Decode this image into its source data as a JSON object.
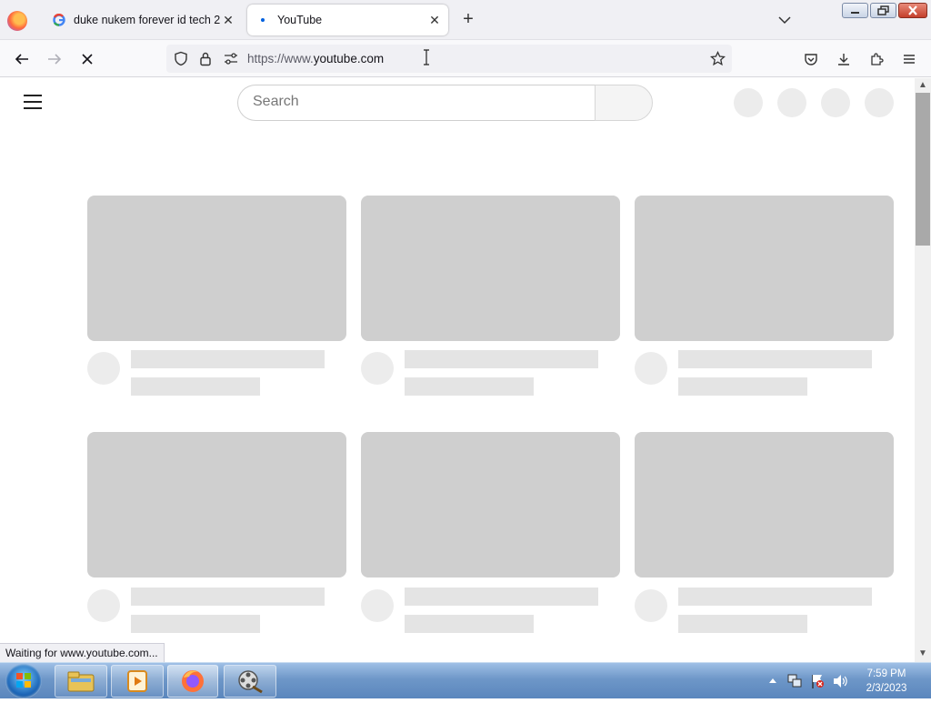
{
  "browser": {
    "tabs": [
      {
        "title": "duke nukem forever id tech 2 -",
        "favicon": "google-g-icon",
        "active": false
      },
      {
        "title": "YouTube",
        "favicon": "loading-dot-icon",
        "active": true
      }
    ],
    "address_bar": {
      "scheme_prefix": "https://www.",
      "domain": "youtube.com"
    },
    "status_text": "Waiting for www.youtube.com..."
  },
  "page": {
    "search": {
      "placeholder": "Search"
    }
  },
  "taskbar": {
    "clock_time": "7:59 PM",
    "clock_date": "2/3/2023"
  },
  "colors": {
    "accent": "#0060df",
    "skeleton": "#cfcfcf"
  }
}
